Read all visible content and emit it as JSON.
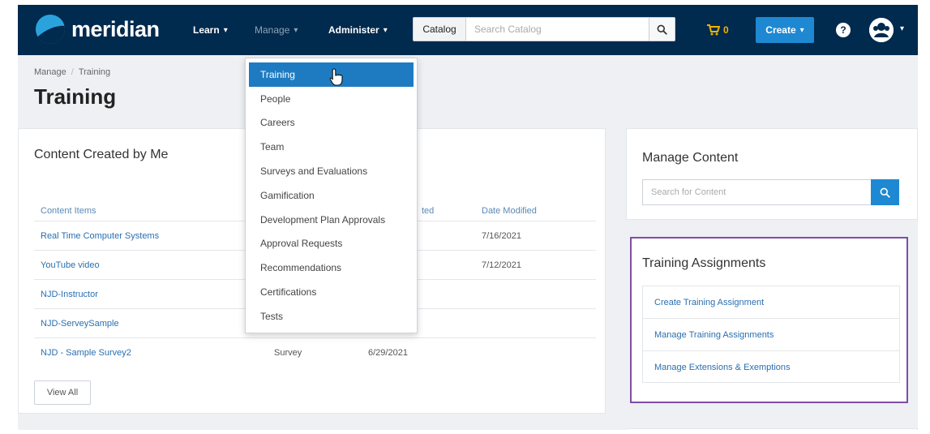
{
  "nav": {
    "logo_text": "meridian",
    "learn": "Learn",
    "manage": "Manage",
    "administer": "Administer",
    "catalog_label": "Catalog",
    "search_placeholder": "Search Catalog",
    "cart_count": "0",
    "create": "Create"
  },
  "breadcrumb": {
    "parent": "Manage",
    "sep": "/",
    "current": "Training"
  },
  "page_title": "Training",
  "content_card": {
    "title": "Content Created by Me",
    "headers": {
      "items": "Content Items",
      "created": "ted",
      "modified": "Date Modified"
    },
    "rows": [
      {
        "name": "Real Time Computer Systems",
        "type": "",
        "created": "",
        "modified": "7/16/2021"
      },
      {
        "name": "YouTube video",
        "type": "",
        "created": "",
        "modified": "7/12/2021"
      },
      {
        "name": "NJD-Instructor",
        "type": "",
        "created": "",
        "modified": ""
      },
      {
        "name": "NJD-ServeySample",
        "type": "",
        "created": "",
        "modified": ""
      },
      {
        "name": "NJD - Sample Survey2",
        "type": "Survey",
        "created": "6/29/2021",
        "modified": ""
      }
    ],
    "view_all": "View All"
  },
  "manage_content": {
    "title": "Manage Content",
    "search_placeholder": "Search for Content"
  },
  "training_assignments": {
    "title": "Training Assignments",
    "items": [
      "Create Training Assignment",
      "Manage Training Assignments",
      "Manage Extensions & Exemptions"
    ]
  },
  "manage_menu": {
    "items": [
      "Training",
      "People",
      "Careers",
      "Team",
      "Surveys and Evaluations",
      "Gamification",
      "Development Plan Approvals",
      "Approval Requests",
      "Recommendations",
      "Certifications",
      "Tests"
    ],
    "active_index": 0
  },
  "colors": {
    "navbar": "#002a4e",
    "accent": "#1e88d2",
    "highlight_border": "#7e4ea3",
    "cart": "#f0b400"
  },
  "icons": {
    "search": "search-icon",
    "cart": "cart-icon",
    "help": "help-icon",
    "avatar": "avatar-icon",
    "cursor": "hand-cursor-icon"
  }
}
